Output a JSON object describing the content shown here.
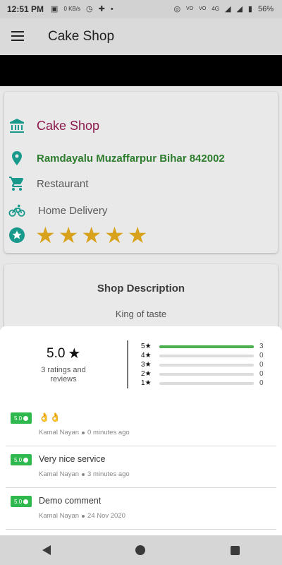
{
  "status_bar": {
    "time": "12:51 PM",
    "battery": "56%",
    "network_label": "4G",
    "speed_label": "0 KB/s",
    "icons": [
      "image-icon",
      "speed-icon",
      "timer-icon",
      "puzzle-icon",
      "dot-icon",
      "hotspot-icon",
      "volte-icon",
      "volte2-icon",
      "signal-icon",
      "signal2-icon",
      "battery-icon"
    ]
  },
  "toolbar": {
    "title": "Cake Shop",
    "menu_icon": "menu-icon"
  },
  "shop_info": {
    "name": "Cake Shop",
    "address": "Ramdayalu Muzaffarpur Bihar 842002",
    "category": "Restaurant",
    "delivery": "Home Delivery",
    "stars": 5,
    "colors": {
      "name": "#8b1b4d",
      "address": "#2e7d2e",
      "icon": "#18998c",
      "star": "#d8a21c"
    }
  },
  "description": {
    "title": "Shop Description",
    "text": "King of taste"
  },
  "ratings": {
    "average": "5.0",
    "caption": "3 ratings and reviews",
    "bars": [
      {
        "label": "5",
        "count": "3",
        "fraction": 1.0
      },
      {
        "label": "4",
        "count": "0",
        "fraction": 0.0
      },
      {
        "label": "3",
        "count": "0",
        "fraction": 0.0
      },
      {
        "label": "2",
        "count": "0",
        "fraction": 0.0
      },
      {
        "label": "1",
        "count": "0",
        "fraction": 0.0
      }
    ],
    "bar_color": "#4caf50"
  },
  "reviews": [
    {
      "badge": "5.0",
      "title": "👌👌",
      "author": "Kamal Nayan",
      "time": "0 minutes ago"
    },
    {
      "badge": "5.0",
      "title": "Very nice service",
      "author": "Kamal Nayan",
      "time": "3 minutes ago"
    },
    {
      "badge": "5.0",
      "title": "Demo comment",
      "author": "Kamal Nayan",
      "time": "24 Nov 2020"
    }
  ]
}
